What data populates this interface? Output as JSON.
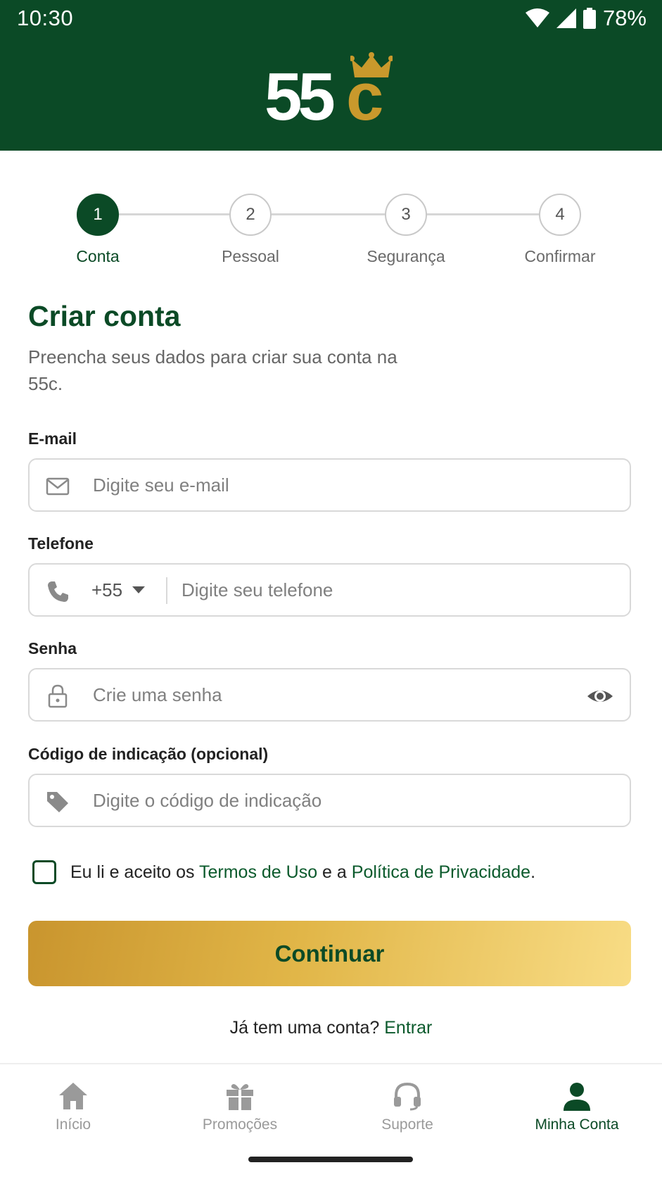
{
  "status_bar": {
    "time": "10:30",
    "battery": "78%"
  },
  "header": {
    "logo_number": "55",
    "logo_letter": "c"
  },
  "stepper": {
    "steps": [
      {
        "number": "1",
        "label": "Conta",
        "active": true
      },
      {
        "number": "2",
        "label": "Pessoal",
        "active": false
      },
      {
        "number": "3",
        "label": "Segurança",
        "active": false
      },
      {
        "number": "4",
        "label": "Confirmar",
        "active": false
      }
    ]
  },
  "form": {
    "title": "Criar conta",
    "subtitle": "Preencha seus dados para criar sua conta na 55c.",
    "email": {
      "label": "E-mail",
      "placeholder": "Digite seu e-mail",
      "icon": "mail-icon"
    },
    "phone": {
      "label": "Telefone",
      "country_code": "+55",
      "placeholder": "Digite seu telefone",
      "icon": "phone-icon"
    },
    "password": {
      "label": "Senha",
      "placeholder": "Crie uma senha",
      "icon": "lock-icon"
    },
    "referral": {
      "label": "Código de indicação (opcional)",
      "placeholder": "Digite o código de indicação",
      "icon": "tag-icon"
    },
    "terms": {
      "prefix": "Eu li e aceito os ",
      "terms_link": "Termos de Uso",
      "middle": " e a ",
      "privacy_link": "Política de Privacidade",
      "suffix": "."
    },
    "continue_label": "Continuar",
    "login_prompt": "Já tem uma conta?",
    "login_link": "Entrar"
  },
  "bottom_nav": {
    "items": [
      {
        "label": "Início",
        "icon": "home-icon",
        "active": false
      },
      {
        "label": "Promoções",
        "icon": "gift-icon",
        "active": false
      },
      {
        "label": "Suporte",
        "icon": "headset-icon",
        "active": false
      },
      {
        "label": "Minha Conta",
        "icon": "user-icon",
        "active": true
      }
    ]
  },
  "colors": {
    "brand_green": "#0b4a26",
    "brand_gold": "#c9992c"
  }
}
